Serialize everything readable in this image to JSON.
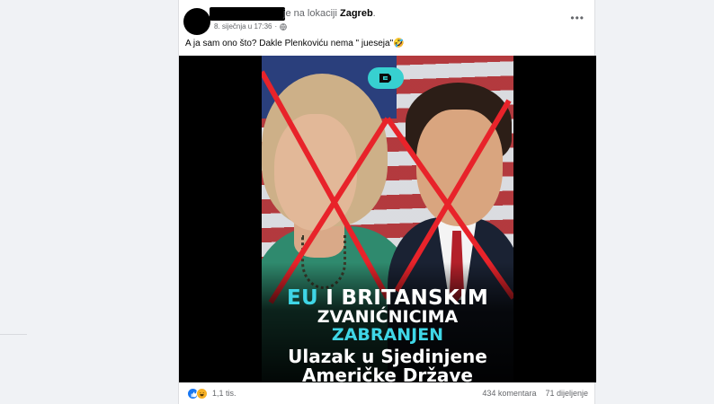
{
  "post": {
    "location_prefix": "je na lokaciji",
    "location_name": "Zagreb",
    "date": "8. siječnja u 17:36",
    "dot": "·",
    "more_label": "•••",
    "caption": "A ja sam ono što?  Dakle Plenkoviću nema \" juesejа\"🤣",
    "reaction_count": "1,1 tis.",
    "comments": "434 komentara",
    "shares": "71 dijeljenje"
  },
  "image": {
    "line1_accent": "EU",
    "line1_rest": " I BRITANSKIM",
    "line2_main": "ZVANIĆNICIMA ",
    "line2_accent": "ZABRANJEN",
    "line3": "Ulazak u Sjedinjene",
    "line4": "Američke Države"
  },
  "colors": {
    "accent": "#3fd6e6",
    "like_blue": "#1877f2",
    "cross_red": "#e8232a",
    "logo_teal": "#37d0d0"
  }
}
